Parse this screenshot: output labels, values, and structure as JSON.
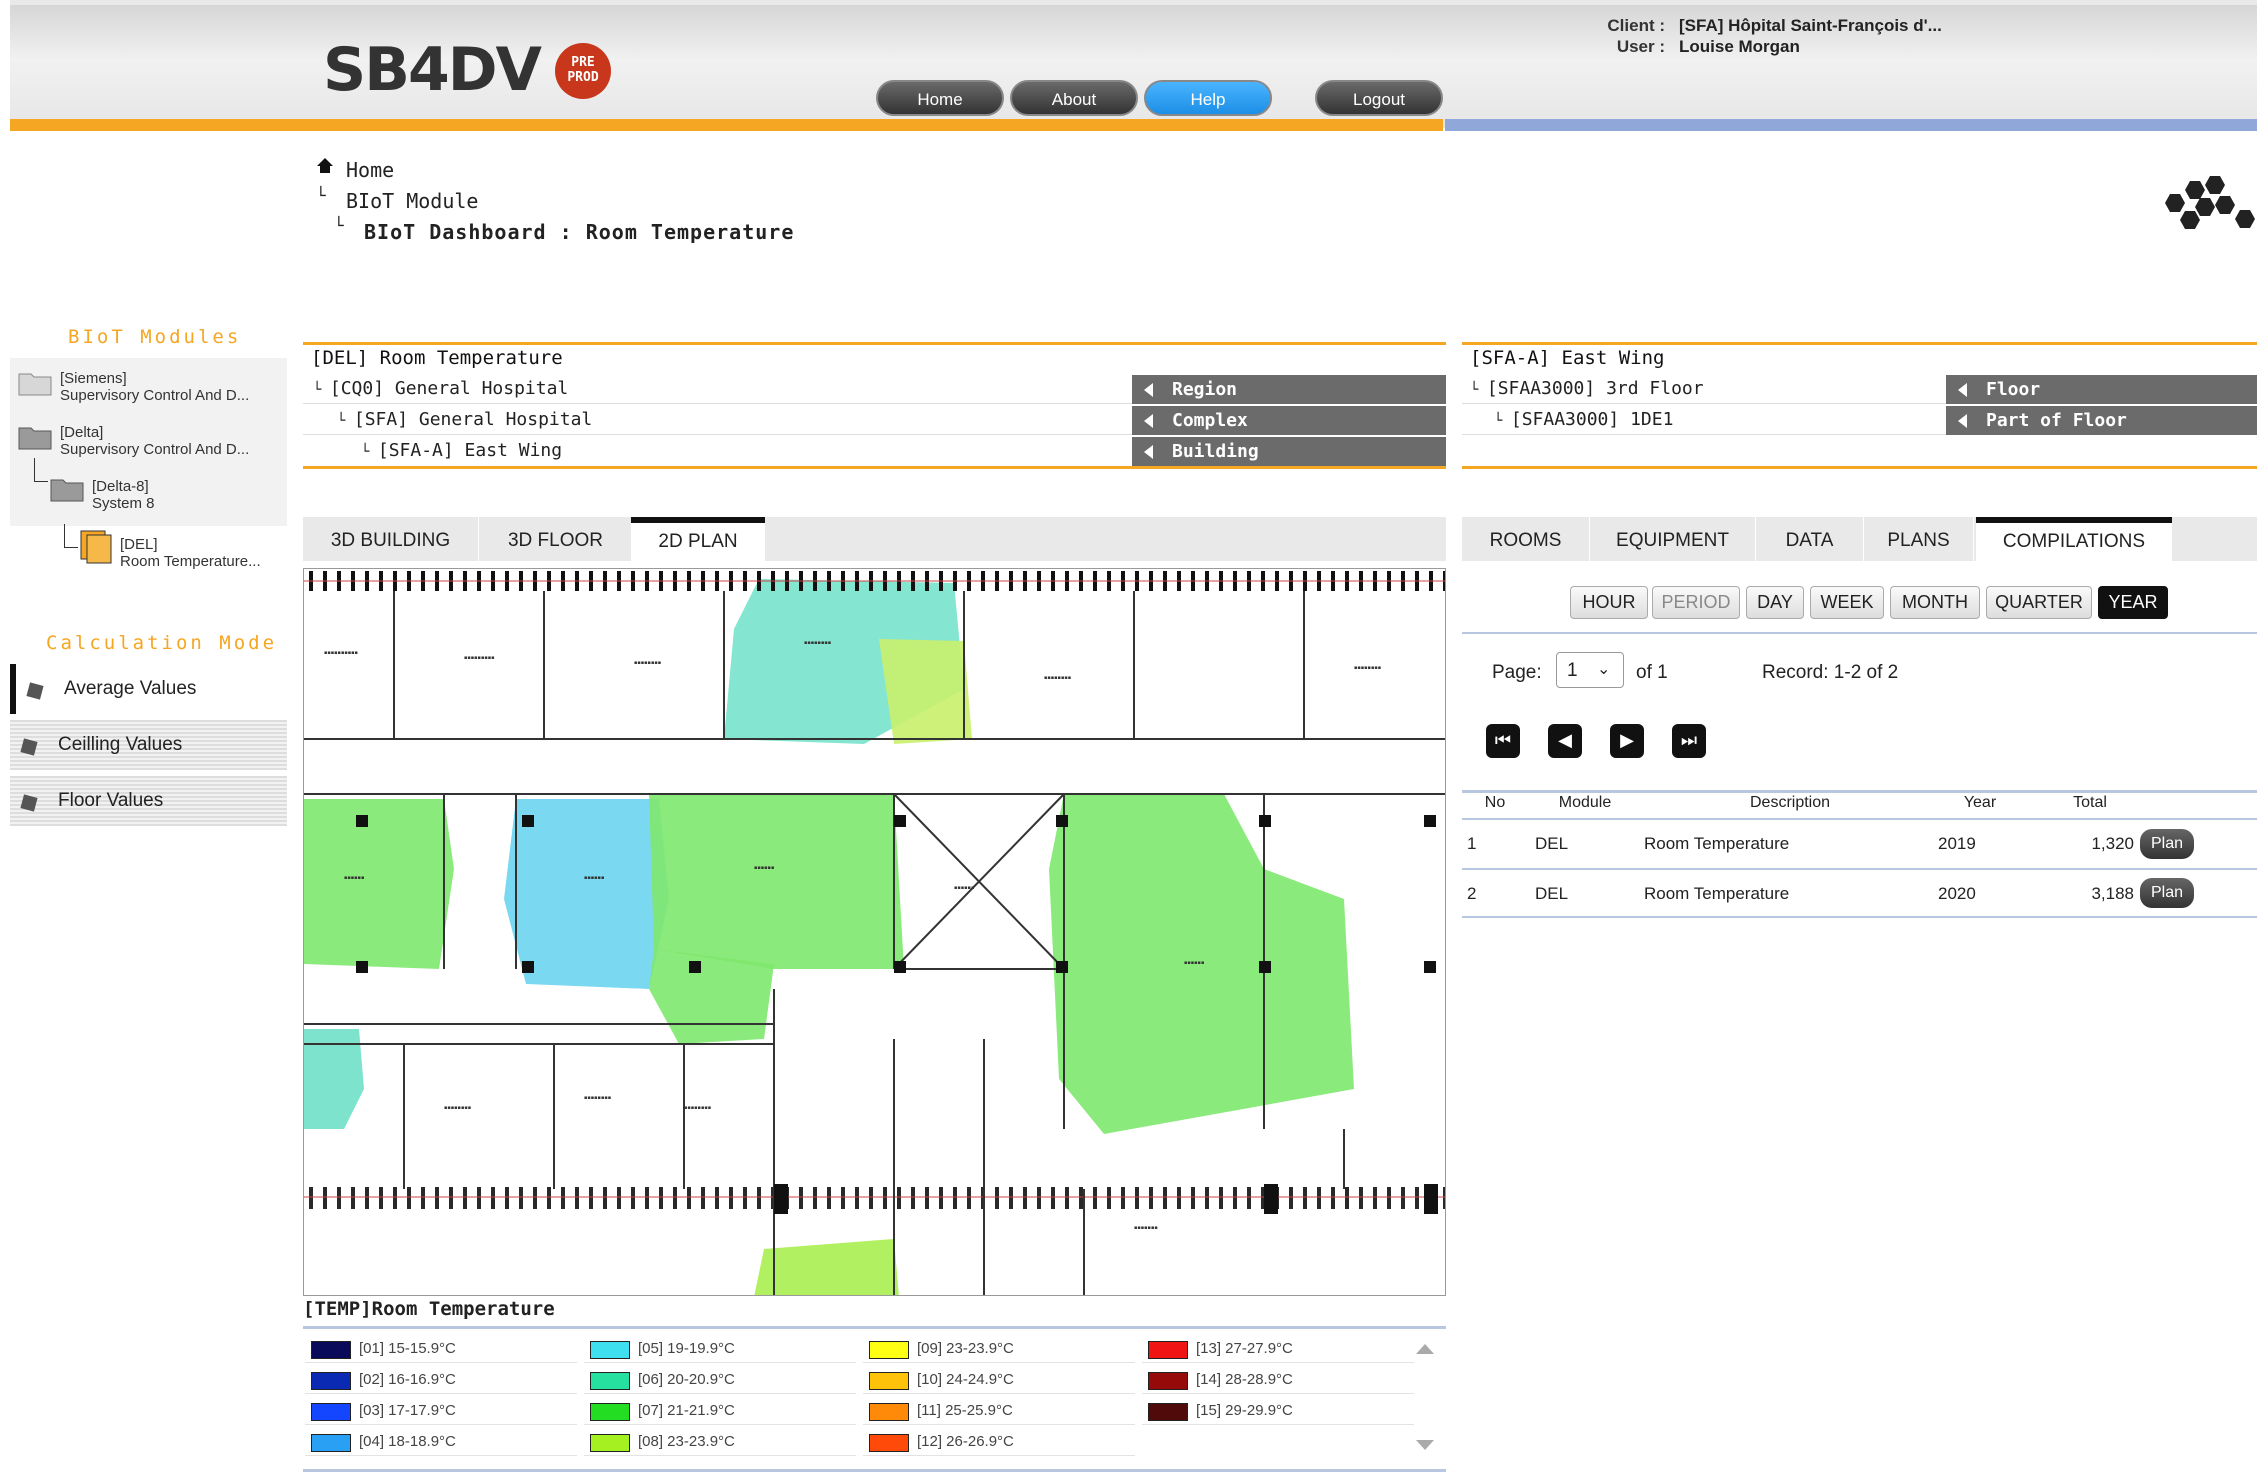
{
  "header": {
    "logo": "SB4DV",
    "badge": "PRE PROD",
    "nav": [
      "Home",
      "About",
      "Help",
      "Logout"
    ],
    "client_label": "Client :",
    "client_value": "[SFA] Hôpital Saint-François d'...",
    "user_label": "User :",
    "user_value": "Louise Morgan"
  },
  "breadcrumb": {
    "home": "Home",
    "module": "BIoT Module",
    "current": "BIoT Dashboard : Room Temperature"
  },
  "sidebar": {
    "modules_title": "BIoT Modules",
    "tree": [
      {
        "line1": "[Siemens]",
        "line2": "Supervisory Control And D..."
      },
      {
        "line1": "[Delta]",
        "line2": "Supervisory Control And D..."
      },
      {
        "line1": "[Delta-8]",
        "line2": "System 8"
      },
      {
        "line1": "[DEL]",
        "line2": "Room Temperature..."
      }
    ],
    "calc_title": "Calculation Mode",
    "calc_modes": [
      "Average Values",
      "Ceilling Values",
      "Floor Values"
    ]
  },
  "left_panel": {
    "header": "[DEL] Room Temperature",
    "paths": [
      "[CQ0] General Hospital",
      "[SFA] General Hospital",
      "[SFA-A] East Wing"
    ],
    "levels": [
      "Region",
      "Complex",
      "Building"
    ],
    "tabs": [
      "3D BUILDING",
      "3D FLOOR",
      "2D PLAN"
    ],
    "active_tab": "2D PLAN"
  },
  "right_panel": {
    "header": "[SFA-A] East Wing",
    "paths": [
      "[SFAA3000] 3rd Floor",
      "[SFAA3000] 1DE1"
    ],
    "levels": [
      "Floor",
      "Part of Floor"
    ],
    "tabs": [
      "ROOMS",
      "EQUIPMENT",
      "DATA",
      "PLANS",
      "COMPILATIONS"
    ],
    "active_tab": "COMPILATIONS",
    "periods": [
      "HOUR",
      "PERIOD",
      "DAY",
      "WEEK",
      "MONTH",
      "QUARTER",
      "YEAR"
    ],
    "active_period": "YEAR",
    "page_label": "Page:",
    "page_value": "1",
    "page_of": "of 1",
    "record_text": "Record: 1-2 of 2",
    "columns": [
      "No",
      "Module",
      "Description",
      "Year",
      "Total"
    ],
    "rows": [
      {
        "no": "1",
        "module": "DEL",
        "description": "Room Temperature",
        "year": "2019",
        "total": "1,320",
        "action": "Plan"
      },
      {
        "no": "2",
        "module": "DEL",
        "description": "Room Temperature",
        "year": "2020",
        "total": "3,188",
        "action": "Plan"
      }
    ]
  },
  "legend": {
    "title": "[TEMP]Room Temperature",
    "items": [
      {
        "label": "[01] 15-15.9°C",
        "color": "#0a0a5a"
      },
      {
        "label": "[02] 16-16.9°C",
        "color": "#0a2ab4"
      },
      {
        "label": "[03] 17-17.9°C",
        "color": "#1446ff"
      },
      {
        "label": "[04] 18-18.9°C",
        "color": "#2aa0f5"
      },
      {
        "label": "[05] 19-19.9°C",
        "color": "#3ee0f0"
      },
      {
        "label": "[06] 20-20.9°C",
        "color": "#26e0a0"
      },
      {
        "label": "[07] 21-21.9°C",
        "color": "#22dd22"
      },
      {
        "label": "[08] 23-23.9°C",
        "color": "#a4f020"
      },
      {
        "label": "[09] 23-23.9°C",
        "color": "#ffff14"
      },
      {
        "label": "[10] 24-24.9°C",
        "color": "#ffc20a"
      },
      {
        "label": "[11] 25-25.9°C",
        "color": "#ff8a0a"
      },
      {
        "label": "[12] 26-26.9°C",
        "color": "#ff4a0a"
      },
      {
        "label": "[13] 27-27.9°C",
        "color": "#f01414"
      },
      {
        "label": "[14] 28-28.9°C",
        "color": "#960a0a"
      },
      {
        "label": "[15] 29-29.9°C",
        "color": "#500a0a"
      }
    ]
  },
  "colors": {
    "orange": "#f5a623",
    "blue": "#8fa7d9",
    "zone_green": "#7ee86e",
    "zone_cyan": "#6fe0d0",
    "zone_blue": "#6cd4f0",
    "zone_yellowgreen": "#c9f06a"
  }
}
